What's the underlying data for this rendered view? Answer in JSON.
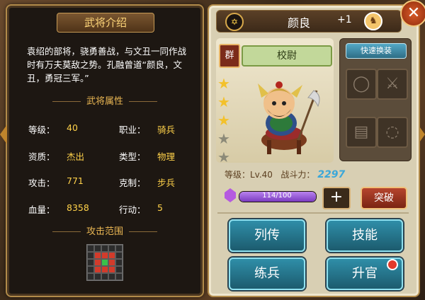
{
  "left_panel": {
    "title": "武将介绍",
    "bio": "袁绍的部将，骁勇善战，与文丑一同作战时有万夫莫敌之势。孔融曾道“颜良，文丑，勇冠三军。”",
    "attributes_title": "武将属性",
    "attributes": [
      {
        "label": "等级：",
        "value": "40"
      },
      {
        "label": "职业：",
        "value": "骑兵"
      },
      {
        "label": "资质：",
        "value": "杰出"
      },
      {
        "label": "类型：",
        "value": "物理"
      },
      {
        "label": "攻击：",
        "value": "771"
      },
      {
        "label": "克制：",
        "value": "步兵"
      },
      {
        "label": "血量：",
        "value": "8358"
      },
      {
        "label": "行动：",
        "value": "5"
      }
    ],
    "range_title": "攻击范围"
  },
  "right_panel": {
    "hero_name": "颜良",
    "plus_level": "+1",
    "faction_icon": "star-emblem-icon",
    "mount_icon": "horse-icon",
    "faction_badge": "群",
    "rank": "校尉",
    "quick_swap_label": "快速换装",
    "stars": {
      "filled": 3,
      "total": 5
    },
    "equipment_slots": [
      "ring-icon",
      "axe-icon",
      "scroll-icon",
      "necklace-icon"
    ],
    "level_text": "等级：Lv.40",
    "power_label": "战斗力：",
    "power_value": "2297",
    "exp_text": "114/100",
    "exp_fraction": 1.0,
    "plus_label": "+",
    "break_label": "突破",
    "buttons": {
      "biography": "列传",
      "skills": "技能",
      "train": "练兵",
      "promote": "升官"
    },
    "close_label": "✕"
  }
}
